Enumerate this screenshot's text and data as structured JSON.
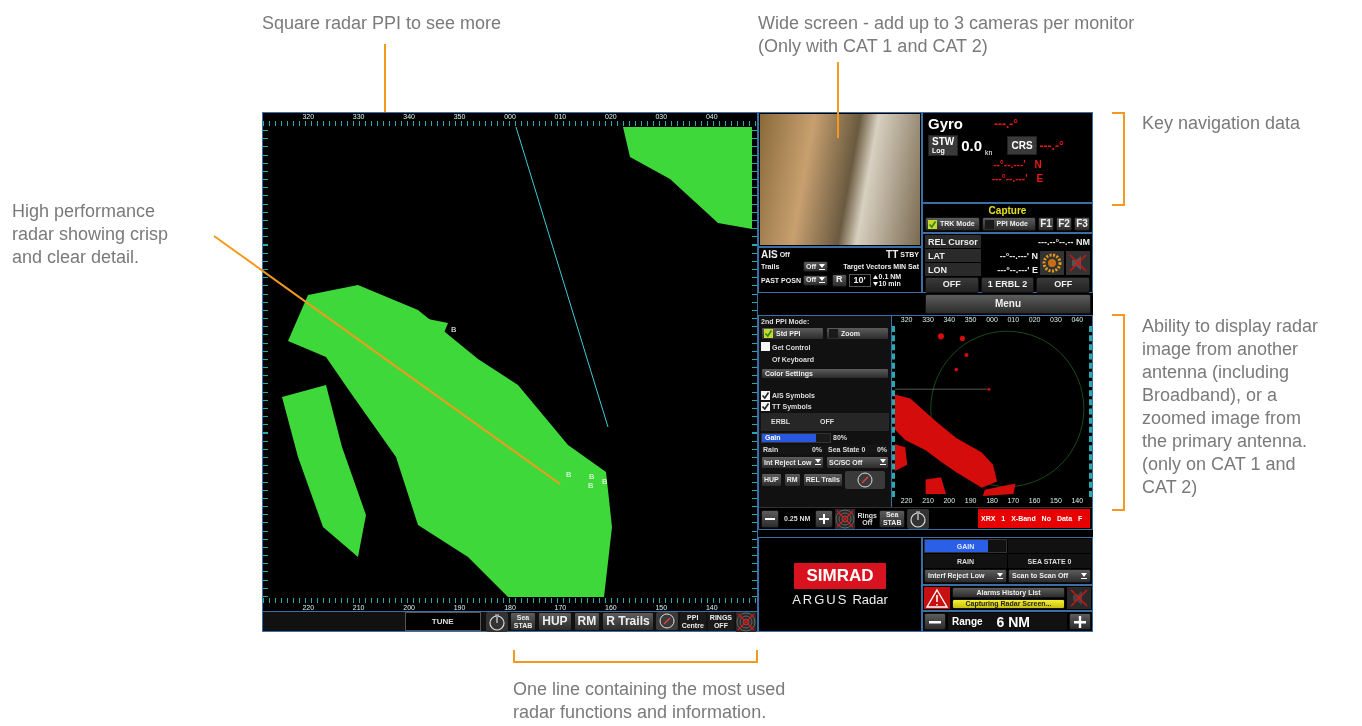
{
  "callouts": [
    {
      "lines": [
        "Square radar PPI to see more"
      ]
    },
    {
      "lines": [
        "Wide screen - add up to 3 cameras per monitor",
        "(Only with CAT 1 and CAT 2)"
      ]
    },
    {
      "lines": [
        "Key navigation data"
      ]
    },
    {
      "lines": [
        "High performance",
        "radar showing crisp",
        "and clear detail."
      ]
    },
    {
      "lines": [
        "Ability to display radar",
        "image from another",
        "antenna (including",
        "Broadband), or a",
        "zoomed image from",
        "the primary antenna.",
        "(only on CAT 1 and",
        "CAT 2)"
      ]
    },
    {
      "lines": [
        "One line containing the most used",
        "radar functions and information."
      ]
    }
  ],
  "main_ppi": {
    "top_scale": [
      "320",
      "330",
      "340",
      "350",
      "000",
      "010",
      "020",
      "030",
      "040"
    ],
    "bottom_scale": [
      "220",
      "210",
      "200",
      "190",
      "180",
      "170",
      "160",
      "150",
      "140"
    ],
    "target_labels": [
      "B",
      "B",
      "B",
      "B",
      "B"
    ],
    "bottom_bar": {
      "tune": "TUNE",
      "sea_stab": [
        "Sea",
        "STAB"
      ],
      "modes": [
        "HUP",
        "RM",
        "R Trails"
      ],
      "ppi_centre": [
        "PPI",
        "Centre"
      ],
      "rings": [
        "RINGS",
        "OFF"
      ]
    }
  },
  "nav_data": {
    "heading_label": "Gyro",
    "heading_value": "---.-°",
    "stw_label": "STW",
    "stw_source": "Log",
    "stw_value": "0.0",
    "stw_unit": "kn",
    "crs_label": "CRS",
    "crs_value": "---.-°",
    "lat_value": "--°--.---'",
    "lat_hemisphere": "N",
    "lon_value": "---°--.---'",
    "lon_hemisphere": "E"
  },
  "capture": {
    "title": "Capture",
    "modes": [
      {
        "label": "TRK Mode",
        "checked": true
      },
      {
        "label": "PPI Mode",
        "checked": false
      }
    ],
    "function_keys": [
      "F1",
      "F2",
      "F3"
    ]
  },
  "cursor": {
    "label": "REL Cursor",
    "value": "---.--°--.--",
    "unit": "NM",
    "lat_label": "LAT",
    "lat_value": "--°--.---'",
    "lat_hemisphere": "N",
    "lon_label": "LON",
    "lon_value": "---°--.---'",
    "lon_hemisphere": "E",
    "erbl_left": "OFF",
    "erbl_label": "1 ERBL 2",
    "erbl_right": "OFF"
  },
  "ais": {
    "title": "AIS",
    "status": "Off",
    "tt_title": "TT",
    "tt_status": "STBY",
    "trails_label": "Trails",
    "trails_value": "Off",
    "past_posn_label": "PAST POSN",
    "past_posn_value": "Off",
    "vectors_label": "Target Vectors",
    "sat_label": "MIN Sat",
    "vector_mode": "R",
    "vector_time": "10'",
    "step_up": "0.1 NM",
    "step_down": "10 min"
  },
  "menu": "Menu",
  "second_ppi": {
    "mode_label": "2nd PPI Mode:",
    "modes": [
      {
        "label": "Std PPI",
        "checked": true
      },
      {
        "label": "Zoom",
        "checked": false
      }
    ],
    "get_control": {
      "lines": [
        "Get Control",
        "Of Keyboard"
      ],
      "checked": false
    },
    "color_settings": "Color Settings",
    "symbols": [
      {
        "label": "AIS Symbols",
        "checked": true
      },
      {
        "label": "TT Symbols",
        "checked": true
      }
    ],
    "erbl_label": "ERBL",
    "erbl_value": "OFF",
    "gain": {
      "label": "Gain",
      "value": "80%",
      "level": 0.8
    },
    "rain": {
      "label": "Rain",
      "value": "0%"
    },
    "sea_state": {
      "label": "Sea State 0",
      "value": "0%"
    },
    "interference": "Int Reject Low",
    "scan": "SC/SC Off",
    "modes_bottom": [
      "HUP",
      "RM",
      "REL Trails"
    ],
    "range": "0.25 NM",
    "rings": [
      "Rings",
      "Off"
    ],
    "sea_stab": [
      "Sea",
      "STAB"
    ],
    "status": "XRX 1 X-Band No Data F",
    "top_scale": [
      "320",
      "330",
      "340",
      "350",
      "000",
      "010",
      "020",
      "030",
      "040"
    ],
    "bottom_scale": [
      "220",
      "210",
      "200",
      "190",
      "180",
      "170",
      "160",
      "150",
      "140"
    ]
  },
  "logo": {
    "brand": "SIMRAD",
    "product": "ARGUS",
    "product_suffix": "Radar"
  },
  "controls": {
    "gain": {
      "label": "GAIN",
      "level": 0.78
    },
    "rain": "RAIN",
    "sea_state": "SEA STATE 0",
    "interference": "Interf Reject Low",
    "scan": "Scan to Scan Off",
    "alarm_history": "Alarms History List",
    "alarm_message": "Capturing Radar Screen...",
    "range_label": "Range",
    "range_value": "6 NM"
  }
}
